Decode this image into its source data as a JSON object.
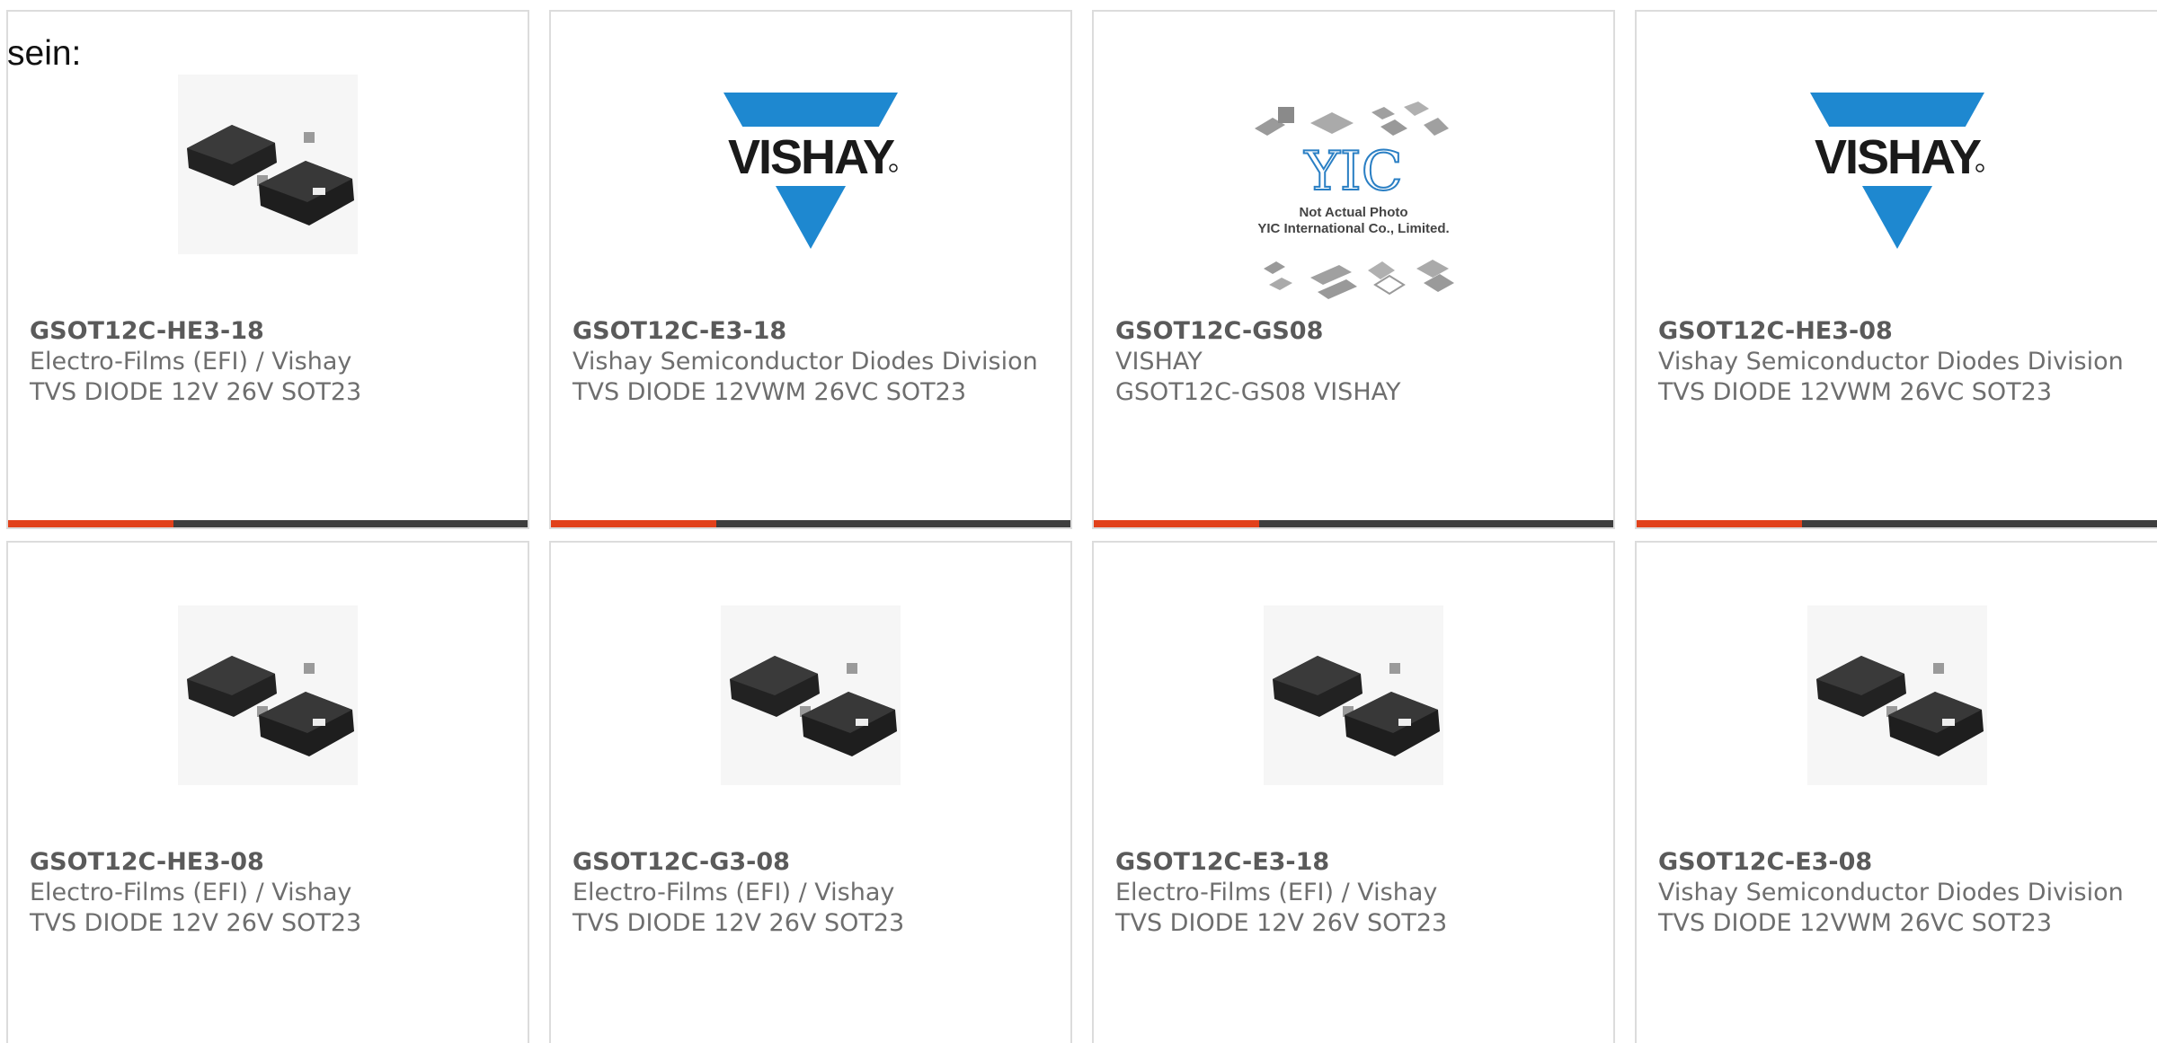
{
  "intro_text": "sein:",
  "accent_color": "#e1411b",
  "bar_color": "#3e3e3e",
  "products": [
    {
      "part_number": "GSOT12C-HE3-18",
      "manufacturer": "Electro-Films (EFI) / Vishay",
      "description": "TVS DIODE 12V 26V SOT23",
      "image": "sot23-package-photo"
    },
    {
      "part_number": "GSOT12C-E3-18",
      "manufacturer": "Vishay Semiconductor Diodes Division",
      "description": "TVS DIODE 12VWM 26VC SOT23",
      "image": "vishay-logo",
      "logo_text": "VISHAY"
    },
    {
      "part_number": "GSOT12C-GS08",
      "manufacturer": "VISHAY",
      "description": "GSOT12C-GS08 VISHAY",
      "image": "yic-placeholder",
      "logo_text": "YIC",
      "photo_note_1": "Not Actual Photo",
      "photo_note_2": "YIC International Co., Limited."
    },
    {
      "part_number": "GSOT12C-HE3-08",
      "manufacturer": "Vishay Semiconductor Diodes Division",
      "description": "TVS DIODE 12VWM 26VC SOT23",
      "image": "vishay-logo",
      "logo_text": "VISHAY"
    },
    {
      "part_number": "GSOT12C-HE3-08",
      "manufacturer": "Electro-Films (EFI) / Vishay",
      "description": "TVS DIODE 12V 26V SOT23",
      "image": "sot23-package-photo"
    },
    {
      "part_number": "GSOT12C-G3-08",
      "manufacturer": "Electro-Films (EFI) / Vishay",
      "description": "TVS DIODE 12V 26V SOT23",
      "image": "sot23-package-photo"
    },
    {
      "part_number": "GSOT12C-E3-18",
      "manufacturer": "Electro-Films (EFI) / Vishay",
      "description": "TVS DIODE 12V 26V SOT23",
      "image": "sot23-package-photo"
    },
    {
      "part_number": "GSOT12C-E3-08",
      "manufacturer": "Vishay Semiconductor Diodes Division",
      "description": "TVS DIODE 12VWM 26VC SOT23",
      "image": "sot23-package-photo"
    }
  ]
}
